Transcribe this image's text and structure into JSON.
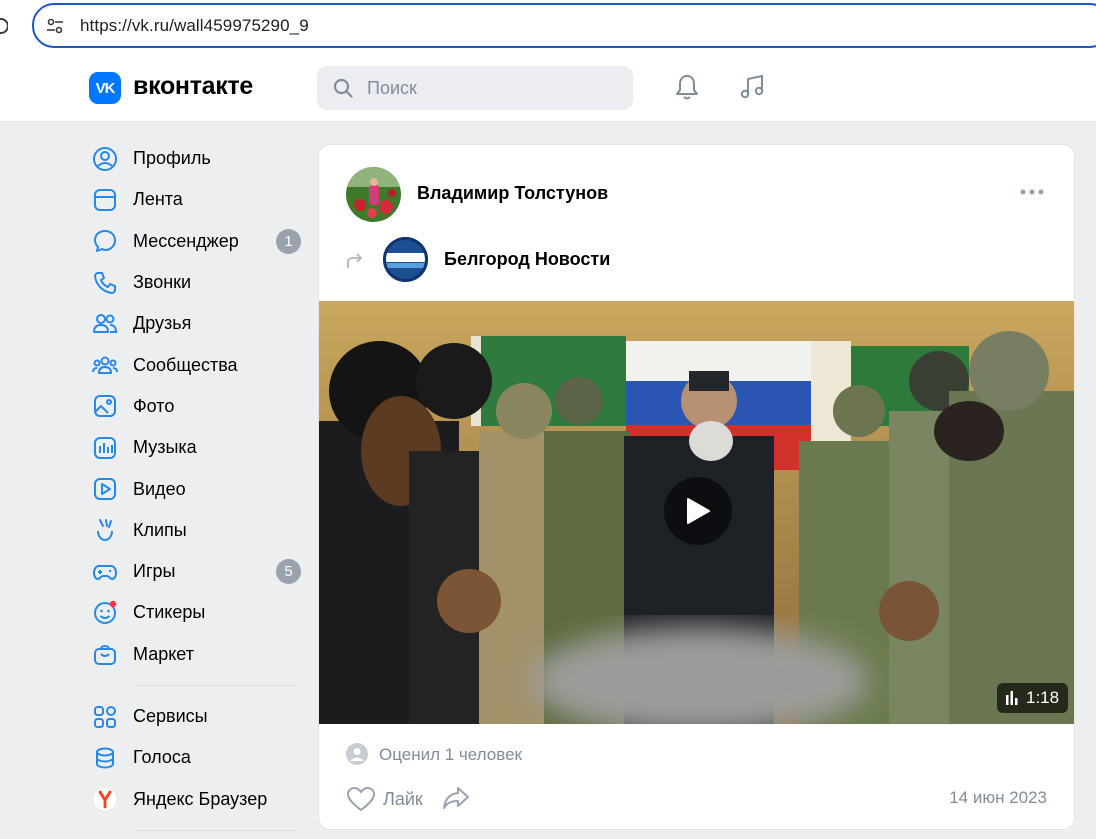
{
  "browser": {
    "url": "https://vk.ru/wall459975290_9"
  },
  "header": {
    "logo_text": "VK",
    "wordmark": "вконтакте",
    "search_placeholder": "Поиск",
    "accent_color": "#0077ff"
  },
  "sidebar": {
    "items": [
      {
        "label": "Профиль",
        "icon": "user-circle-icon"
      },
      {
        "label": "Лента",
        "icon": "news-feed-icon"
      },
      {
        "label": "Мессенджер",
        "icon": "chat-bubble-icon",
        "badge": "1"
      },
      {
        "label": "Звонки",
        "icon": "phone-icon"
      },
      {
        "label": "Друзья",
        "icon": "friends-icon"
      },
      {
        "label": "Сообщества",
        "icon": "communities-icon"
      },
      {
        "label": "Фото",
        "icon": "photo-icon"
      },
      {
        "label": "Музыка",
        "icon": "music-icon"
      },
      {
        "label": "Видео",
        "icon": "video-icon"
      },
      {
        "label": "Клипы",
        "icon": "clips-icon"
      },
      {
        "label": "Игры",
        "icon": "gamepad-icon",
        "badge": "5"
      },
      {
        "label": "Стикеры",
        "icon": "sticker-icon"
      },
      {
        "label": "Маркет",
        "icon": "market-bag-icon"
      }
    ],
    "secondary_items": [
      {
        "label": "Сервисы",
        "icon": "services-grid-icon"
      },
      {
        "label": "Голоса",
        "icon": "coins-icon"
      },
      {
        "label": "Яндекс Браузер",
        "icon": "yandex-browser-icon"
      }
    ]
  },
  "post": {
    "author_name": "Владимир Толстунов",
    "source_name": "Белгород Новости",
    "video_duration": "1:18",
    "likers_text": "Оценил 1 человек",
    "like_label": "Лайк",
    "date": "14 июн 2023"
  }
}
